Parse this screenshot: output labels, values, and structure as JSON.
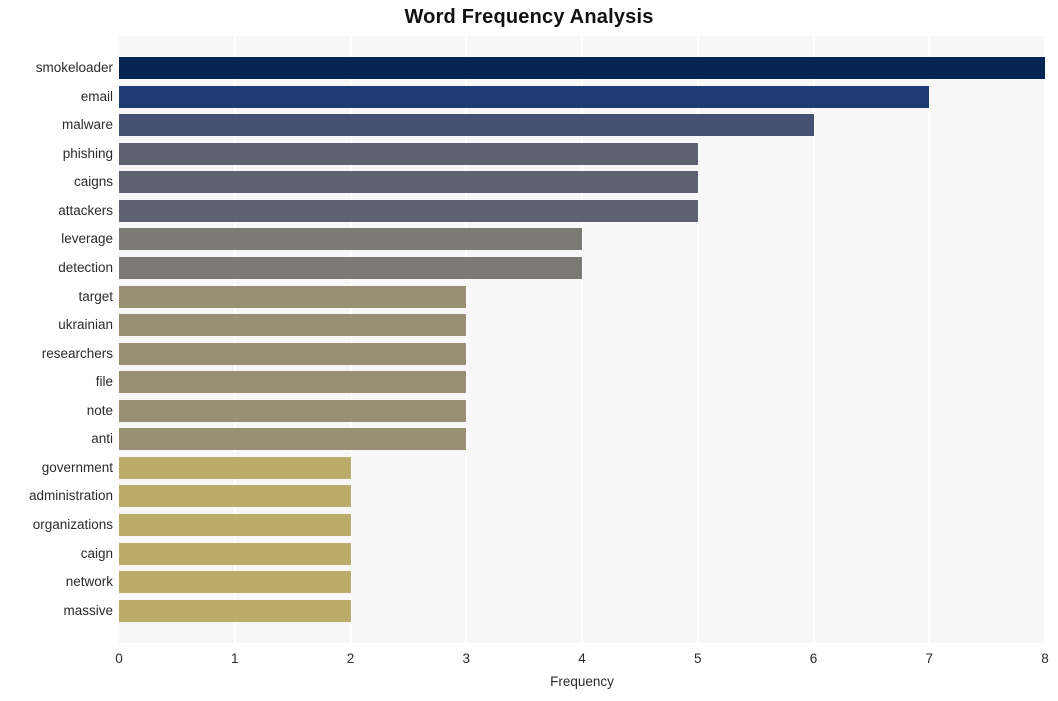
{
  "chart_data": {
    "type": "bar",
    "orientation": "horizontal",
    "title": "Word Frequency Analysis",
    "xlabel": "Frequency",
    "ylabel": "",
    "xlim": [
      0,
      8
    ],
    "xticks": [
      0,
      1,
      2,
      3,
      4,
      5,
      6,
      7,
      8
    ],
    "xtick_labels": [
      "0",
      "1",
      "2",
      "3",
      "4",
      "5",
      "6",
      "7",
      "8"
    ],
    "grid": true,
    "grid_axis": "x",
    "grid_color": "#ffffff",
    "plot_background": "#f7f7f7",
    "figure_background": "#ffffff",
    "legend": null,
    "categories": [
      "smokeloader",
      "email",
      "malware",
      "phishing",
      "caigns",
      "attackers",
      "leverage",
      "detection",
      "target",
      "ukrainian",
      "researchers",
      "file",
      "note",
      "anti",
      "government",
      "administration",
      "organizations",
      "caign",
      "network",
      "massive"
    ],
    "values": [
      8,
      7,
      6,
      5,
      5,
      5,
      4,
      4,
      3,
      3,
      3,
      3,
      3,
      3,
      2,
      2,
      2,
      2,
      2,
      2
    ],
    "bar_colors": [
      "#042453",
      "#1d3b74",
      "#475272",
      "#5d6272",
      "#5d6272",
      "#5d6272",
      "#7b7a74",
      "#7b7a74",
      "#999073",
      "#999073",
      "#999073",
      "#999073",
      "#999073",
      "#999073",
      "#bbac6b",
      "#bbac6b",
      "#bbac6b",
      "#bbac6b",
      "#bbac6b",
      "#bbac6b"
    ]
  }
}
